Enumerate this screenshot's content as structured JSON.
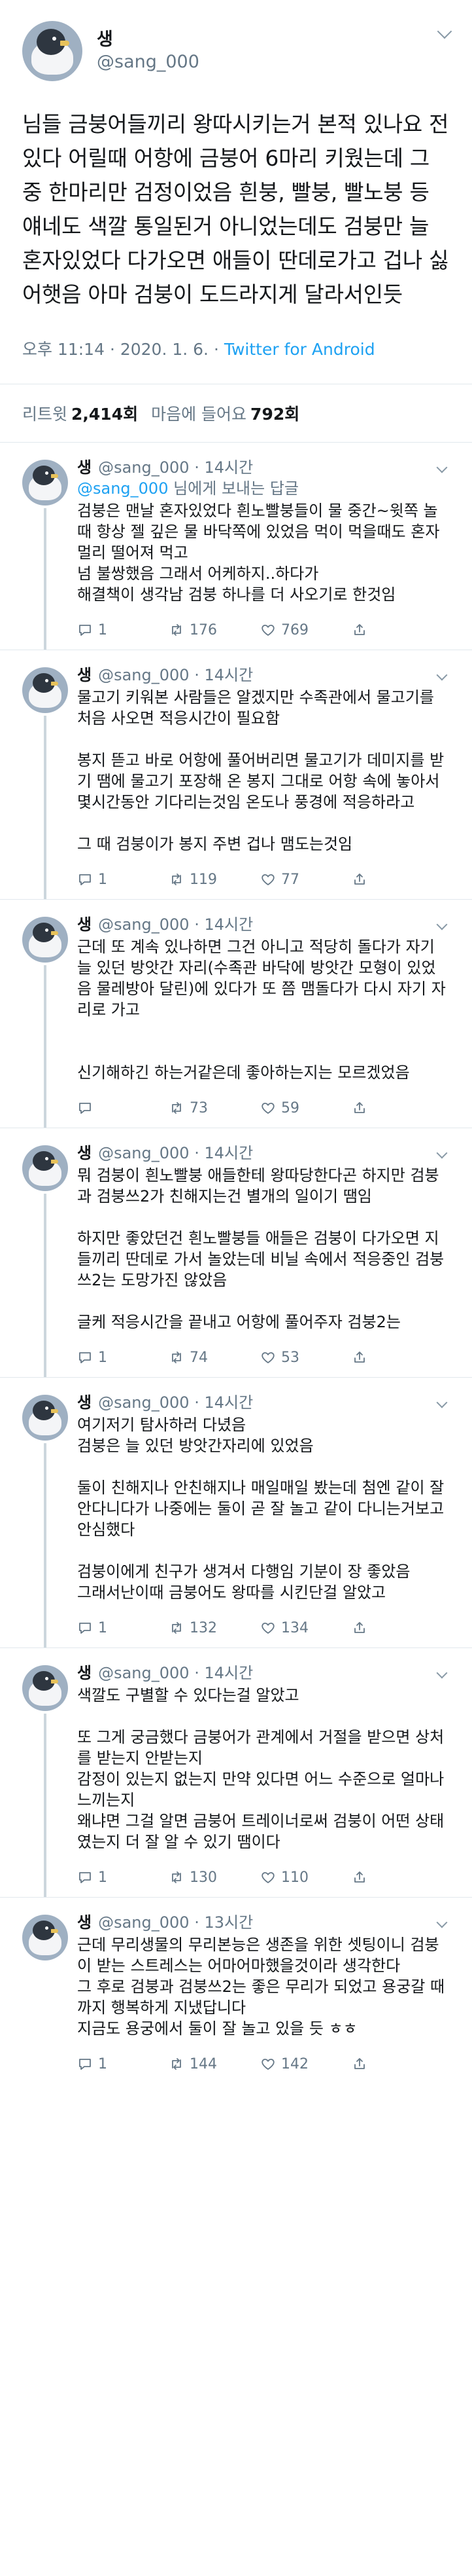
{
  "main_tweet": {
    "display_name": "생",
    "handle": "@sang_000",
    "text": "님들 금붕어들끼리 왕따시키는거 본적 있나요 전 있다 어릴때 어항에 금붕어 6마리 키웠는데 그 중 한마리만 검정이었음 흰붕, 빨붕, 빨노붕 등 얘네도 색깔 통일된거 아니었는데도 검붕만 늘 혼자있었다 다가오면 애들이 딴데로가고 겁나 싫어햇음 아마 검붕이 도드라지게 달라서인듯",
    "timestamp": "오후 11:14 · 2020. 1. 6. · ",
    "source": "Twitter for Android",
    "retweets_label": "리트윗",
    "retweets": "2,414회",
    "likes_label": "마음에 들어요",
    "likes": "792회"
  },
  "replies": [
    {
      "display_name": "생",
      "meta": "@sang_000 · 14시간",
      "replying_mention": "@sang_000",
      "replying_suffix": " 님에게 보내는 답글",
      "text": "검붕은 맨날 혼자있었다 흰노빨붕들이 물 중간~윗쪽 놀때 항상 젤 깊은 물 바닥쪽에 있었음 먹이 먹을때도 혼자 멀리 떨어져 먹고\n넘 불쌍했음 그래서 어케하지..하다가\n해결책이 생각남 검붕 하나를 더 사오기로 한것임",
      "replies": "1",
      "retweets": "176",
      "likes": "769"
    },
    {
      "display_name": "생",
      "meta": "@sang_000 · 14시간",
      "text": "물고기 키워본 사람들은 알겠지만 수족관에서 물고기를 처음 사오면 적응시간이 필요함\n\n봉지 뜯고 바로 어항에 풀어버리면 물고기가 데미지를 받기 땜에 물고기 포장해 온 봉지 그대로 어항 속에 놓아서 몇시간동안 기다리는것임 온도나 풍경에 적응하라고\n\n그 때 검붕이가 봉지 주변 겁나 맴도는것임",
      "replies": "1",
      "retweets": "119",
      "likes": "77"
    },
    {
      "display_name": "생",
      "meta": "@sang_000 · 14시간",
      "text": "근데 또 계속 있나하면 그건 아니고 적당히 돌다가 자기 늘 있던 방앗간 자리(수족관 바닥에 방앗간 모형이 있었음 물레방아 달린)에 있다가 또 쯤 맴돌다가 다시 자기 자리로 가고\n\n\n신기해하긴 하는거같은데 좋아하는지는 모르겠었음",
      "replies": "",
      "retweets": "73",
      "likes": "59"
    },
    {
      "display_name": "생",
      "meta": "@sang_000 · 14시간",
      "text": "뭐 검붕이 흰노빨붕 애들한테 왕따당한다곤 하지만 검붕과 검붕쓰2가 친해지는건 별개의 일이기 땜임\n\n하지만 좋았던건 흰노빨붕들 애들은 검붕이 다가오면 지들끼리 딴데로 가서 놀았는데 비닐 속에서 적응중인 검붕쓰2는 도망가진 않았음\n\n글케 적응시간을 끝내고 어항에 풀어주자 검붕2는",
      "replies": "1",
      "retweets": "74",
      "likes": "53"
    },
    {
      "display_name": "생",
      "meta": "@sang_000 · 14시간",
      "text": "여기저기 탐사하러 다녔음\n검붕은 늘 있던 방앗간자리에 있었음\n\n둘이 친해지나 안친해지나 매일매일 봤는데 첨엔 같이 잘 안다니다가 나중에는 둘이 곧 잘 놀고 같이 다니는거보고 안심했다\n\n검붕이에게 친구가 생겨서 다행임 기분이 장 좋았음\n그래서난이때 금붕어도 왕따를 시킨단걸 알았고",
      "replies": "1",
      "retweets": "132",
      "likes": "134"
    },
    {
      "display_name": "생",
      "meta": "@sang_000 · 14시간",
      "text": "색깔도 구별할 수 있다는걸 알았고\n\n또 그게 궁금했다 금붕어가 관계에서 거절을 받으면 상처를 받는지 안받는지\n감정이 있는지 없는지 만약 있다면 어느 수준으로 얼마나 느끼는지\n왜냐면 그걸 알면 금붕어 트레이너로써 검붕이 어떤 상태였는지 더 잘 알 수 있기 땜이다",
      "replies": "1",
      "retweets": "130",
      "likes": "110"
    },
    {
      "display_name": "생",
      "meta": "@sang_000 · 13시간",
      "text": "근데 무리생물의 무리본능은 생존을 위한 셋팅이니 검붕이 받는 스트레스는 어마어마했을것이라 생각한다\n그 후로 검붕과 검붕쓰2는 좋은 무리가 되었고 용궁갈 때까지 행복하게 지냈답니다\n지금도 용궁에서 둘이 잘 놀고 있을 듯 ㅎㅎ",
      "replies": "1",
      "retweets": "144",
      "likes": "142"
    }
  ]
}
